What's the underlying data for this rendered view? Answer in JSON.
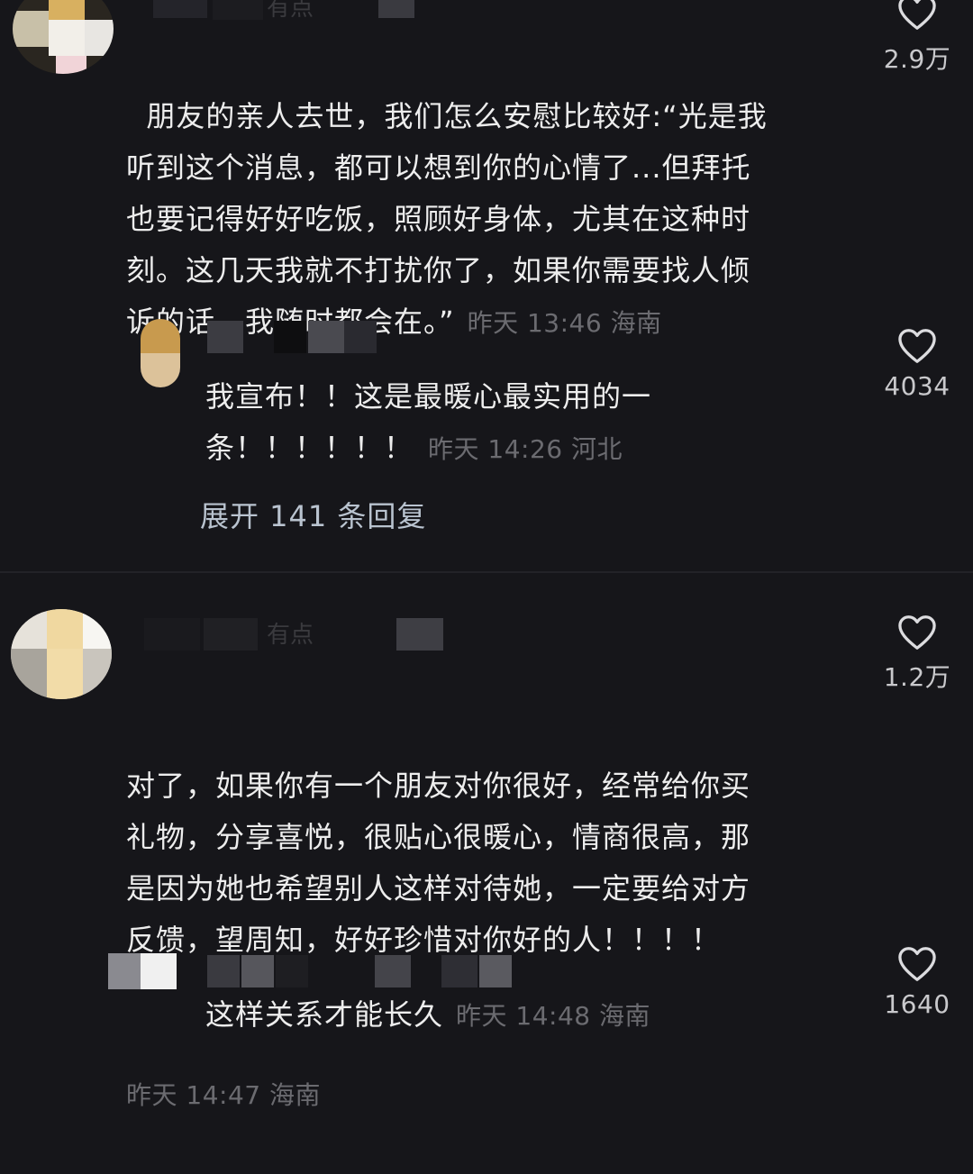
{
  "comments": [
    {
      "text": "朋友的亲人去世，我们怎么安慰比较好:“光是我\n听到这个消息，都可以想到你的心情了...但拜托\n也要记得好好吃饭，照顾好身体，尤其在这种时\n刻。这几天我就不打扰你了，如果你需要找人倾\n诉的话，我随时都会在。”",
      "meta": "昨天 13:46 海南",
      "likes": "2.9万",
      "username_fragment": "有点",
      "reply": {
        "text_line1": "我宣布！！这是最暖心最实用的一",
        "text_line2": "条！！！！！！",
        "meta": "昨天 14:26 河北",
        "likes": "4034"
      },
      "expand_label": "展开 141 条回复"
    },
    {
      "text": "对了，如果你有一个朋友对你很好，经常给你买\n礼物，分享喜悦，很贴心很暖心，情商很高，那\n是因为她也希望别人这样对待她，一定要给对方\n反馈，望周知，好好珍惜对你好的人！！！！",
      "meta": "昨天 14:47 海南",
      "likes": "1.2万",
      "username_fragment": "有点",
      "reply": {
        "text": "这样关系才能长久",
        "meta": "昨天 14:48 海南",
        "likes": "1640"
      }
    }
  ],
  "icons": {
    "like": "heart-outline-icon"
  },
  "colors": {
    "background": "#16161a",
    "text": "#ededed",
    "meta": "#6b6b70",
    "expand": "#b9c3cf"
  }
}
